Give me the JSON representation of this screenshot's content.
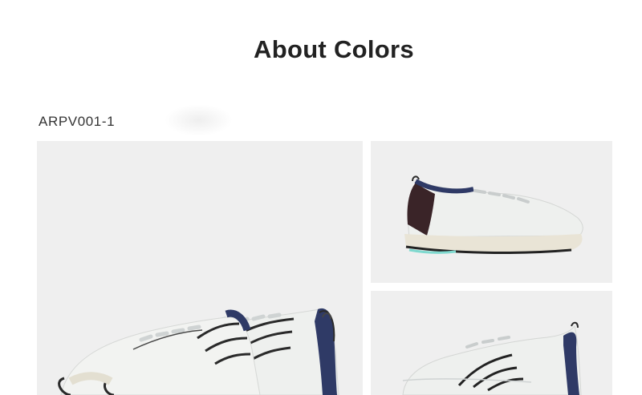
{
  "section": {
    "title": "About Colors"
  },
  "product": {
    "sku": "ARPV001-1"
  },
  "gallery": {
    "images": [
      {
        "name": "shoe-pair-front-view"
      },
      {
        "name": "shoe-side-view"
      },
      {
        "name": "shoe-side-view-close"
      }
    ]
  },
  "colors": {
    "background": "#ffffff",
    "tile": "#efefef",
    "upper": "#eef0ee",
    "midsole": "#e9e4d6",
    "collar": "#2f3a66",
    "heel": "#3a2428",
    "outsole_accent": "#7fd9cf"
  }
}
